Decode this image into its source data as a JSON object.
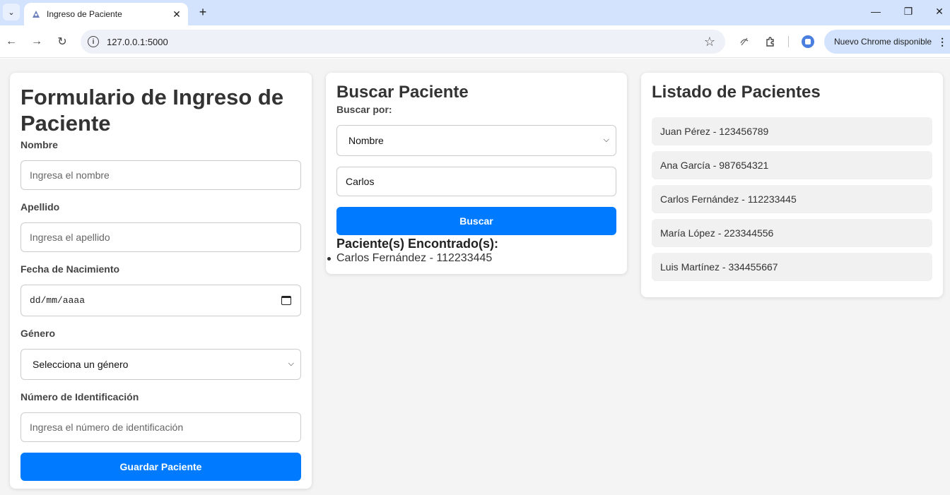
{
  "browser": {
    "tab_title": "Ingreso de Paciente",
    "url": "127.0.0.1:5000",
    "update_label": "Nuevo Chrome disponible"
  },
  "form": {
    "title": "Formulario de Ingreso de Paciente",
    "nombre_label": "Nombre",
    "nombre_placeholder": "Ingresa el nombre",
    "apellido_label": "Apellido",
    "apellido_placeholder": "Ingresa el apellido",
    "fecha_label": "Fecha de Nacimiento",
    "fecha_placeholder": "dd/mm/aaaa",
    "genero_label": "Género",
    "genero_selected": "Selecciona un género",
    "id_label": "Número de Identificación",
    "id_placeholder": "Ingresa el número de identificación",
    "save_button": "Guardar Paciente"
  },
  "search": {
    "title": "Buscar Paciente",
    "by_label": "Buscar por:",
    "by_selected": "Nombre",
    "query_value": "Carlos",
    "button": "Buscar",
    "results_title": "Paciente(s) Encontrado(s):",
    "results": [
      "Carlos Fernández - 112233445"
    ]
  },
  "list": {
    "title": "Listado de Pacientes",
    "patients": [
      "Juan Pérez - 123456789",
      "Ana García - 987654321",
      "Carlos Fernández - 112233445",
      "María López - 223344556",
      "Luis Martínez - 334455667"
    ]
  },
  "colors": {
    "accent": "#007bff",
    "tabbar": "#d3e3fd"
  }
}
